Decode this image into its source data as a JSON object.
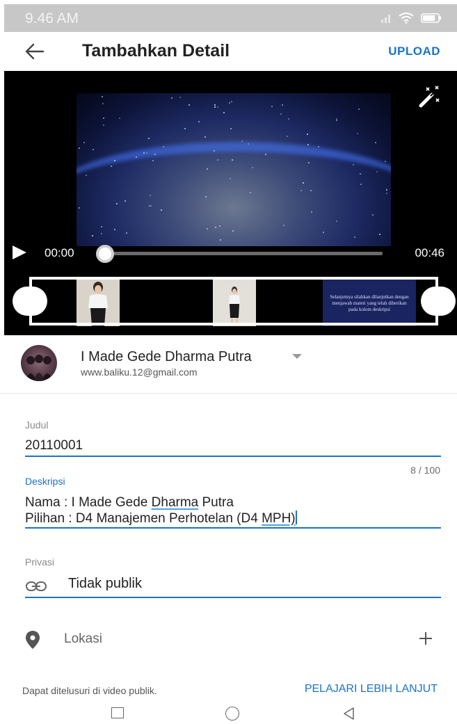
{
  "status_bar": {
    "time": "9.46 AM"
  },
  "app_bar": {
    "title": "Tambahkan Detail",
    "upload_label": "UPLOAD"
  },
  "video": {
    "current_time": "00:00",
    "duration": "00:46",
    "progress_fraction": 0.0,
    "thumbnail_caption": "Selanjutnya silahkan dilanjutkan dengan menjawab materi yang telah diberikan pada kolom deskripsi"
  },
  "account": {
    "name": "I Made Gede Dharma Putra",
    "email": "www.baliku.12@gmail.com"
  },
  "form": {
    "title_label": "Judul",
    "title_value": "20110001",
    "char_counter": "8 / 100",
    "description_label": "Deskripsi",
    "description_line1_prefix": "Nama : I Made Gede ",
    "description_line1_underlined": "Dharma",
    "description_line1_suffix": " Putra",
    "description_line2_prefix": "Pilihan : D4 Manajemen Perhotelan (D4 ",
    "description_line2_underlined": "MPH)",
    "privacy_label": "Privasi",
    "privacy_value": "Tidak publik",
    "location_label": "Lokasi"
  },
  "footer": {
    "note": "Dapat ditelusuri di video publik.",
    "learn_more": "PELAJARI LEBIH LANJUT"
  },
  "colors": {
    "accent": "#1a73c8",
    "status_bar": "#c7c7c7",
    "video_bg": "#000000"
  },
  "icons": {
    "back": "arrow-left-icon",
    "magic": "magic-wand-icon",
    "play": "play-icon",
    "privacy": "link-icon",
    "location": "location-pin-icon",
    "add": "plus-icon"
  }
}
